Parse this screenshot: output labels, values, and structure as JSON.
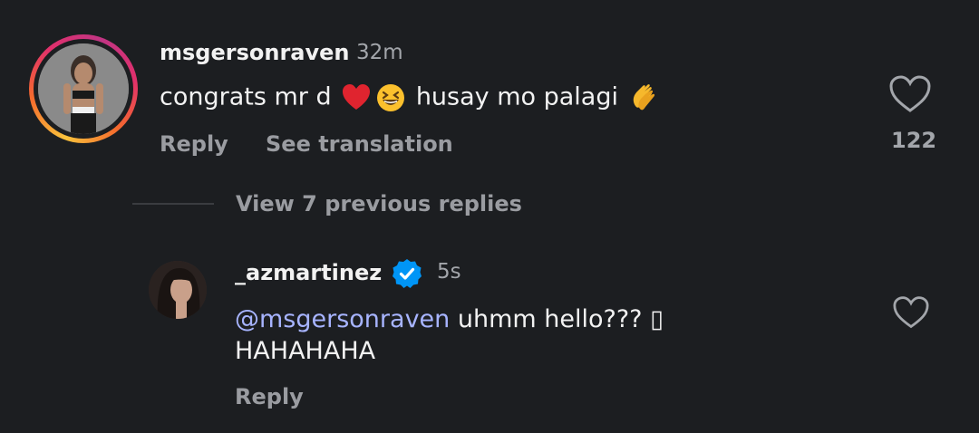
{
  "comment": {
    "username": "msgersonraven",
    "time": "32m",
    "text_part1": "congrats mr d",
    "text_part2": "husay mo palagi",
    "emojis": [
      "red-heart",
      "grinning-squinting-face",
      "clapping-hands"
    ],
    "reply_label": "Reply",
    "translate_label": "See translation",
    "likes": "122",
    "avatar_ring_colors": [
      "#f9c23c",
      "#f56a2d",
      "#e1306c",
      "#c13584"
    ]
  },
  "thread": {
    "view_replies_label": "View 7 previous replies"
  },
  "reply": {
    "username": "_azmartinez",
    "verified": true,
    "verified_color": "#0095f6",
    "time": "5s",
    "mention": "@msgersonraven",
    "text_line1": "uhmm hello??? ▯",
    "text_line2": "HAHAHAHA",
    "reply_label": "Reply"
  }
}
